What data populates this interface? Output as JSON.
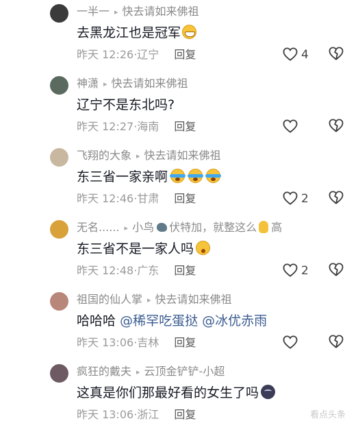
{
  "separator": "▸",
  "comments": [
    {
      "user": "一半一",
      "reply_to": "快去请如来佛祖",
      "text": "去黑龙江也是冠军",
      "emoji": "grin",
      "time": "昨天 12:26",
      "location": "辽宁",
      "reply": "回复",
      "likes": "4"
    },
    {
      "user": "神潇",
      "reply_to": "快去请如来佛祖",
      "text": "辽宁不是东北吗?",
      "emoji": "",
      "time": "昨天 12:27",
      "location": "海南",
      "reply": "回复",
      "likes": ""
    },
    {
      "user": "飞翔的大象",
      "reply_to": "快去请如来佛祖",
      "text": "东三省一家亲啊",
      "emoji": "cry",
      "time": "昨天 12:46",
      "location": "甘肃",
      "reply": "回复",
      "likes": "2"
    },
    {
      "user": "无名......",
      "reply_to": "小鸟",
      "reply_to_after": "伏特加，就整这么",
      "reply_to_tail": "高",
      "text": "东三省不是一家人吗",
      "emoji": "shock",
      "time": "昨天 12:48",
      "location": "广东",
      "reply": "回复",
      "likes": "2"
    },
    {
      "user": "祖国的仙人掌",
      "reply_to": "快去请如来佛祖",
      "text": "哈哈哈",
      "mention1": "@稀罕吃蛋挞",
      "mention2": "@冰优赤雨",
      "emoji": "",
      "time": "昨天 13:06",
      "location": "吉林",
      "reply": "回复",
      "likes": ""
    },
    {
      "user": "疯狂的戴夫",
      "reply_to": "云顶金铲铲-小超",
      "text": "这真是你们那最好看的女生了吗",
      "emoji": "moon",
      "time": "昨天 13:06",
      "location": "浙江",
      "reply": "回复",
      "likes": ""
    }
  ],
  "watermark": "看点头条"
}
